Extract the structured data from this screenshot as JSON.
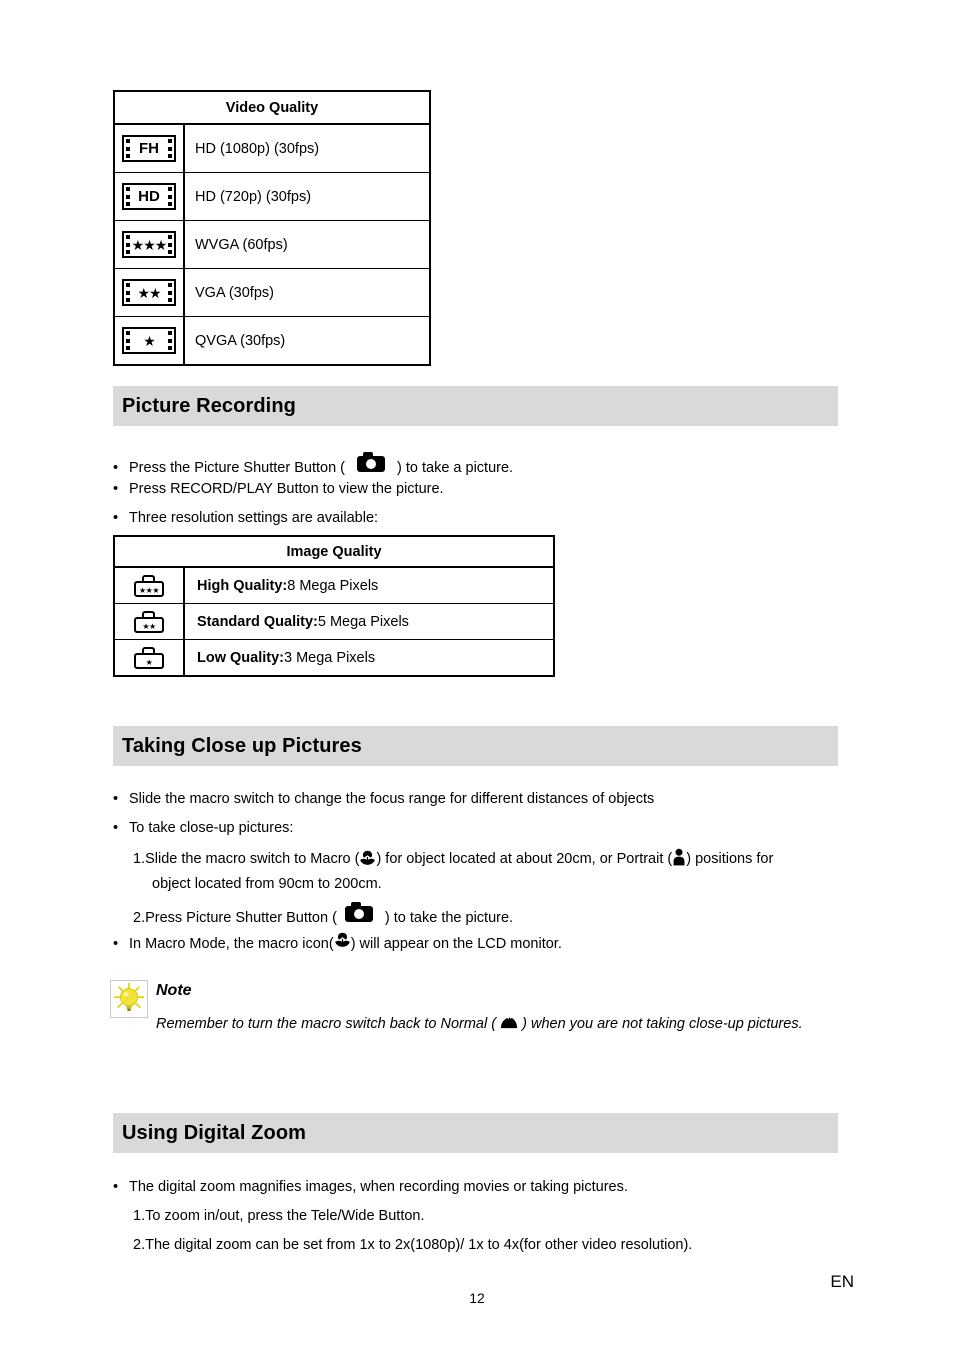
{
  "page": {
    "number": "12",
    "language_code": "EN"
  },
  "video_quality_table": {
    "header": "Video Quality",
    "rows": [
      {
        "icon": "film-fh-icon",
        "icon_text": "FH",
        "icon_kind": "text",
        "label": "HD (1080p) (30fps)"
      },
      {
        "icon": "film-hd-icon",
        "icon_text": "HD",
        "icon_kind": "text",
        "label": "HD (720p) (30fps)"
      },
      {
        "icon": "film-three-star-icon",
        "icon_text": "★★★",
        "icon_kind": "stars",
        "label": "WVGA (60fps)"
      },
      {
        "icon": "film-two-star-icon",
        "icon_text": "★★",
        "icon_kind": "stars",
        "label": "VGA (30fps)"
      },
      {
        "icon": "film-one-star-icon",
        "icon_text": "★",
        "icon_kind": "stars",
        "label": "QVGA (30fps)"
      }
    ]
  },
  "picture_recording": {
    "heading": "Picture Recording",
    "heading_bg": "#d9d9d9",
    "bullets": [
      {
        "pre": "Press the Picture Shutter Button (",
        "icon": "camera-icon",
        "post": ") to take a picture."
      },
      {
        "pre": "Press RECORD/PLAY Button to view the picture.",
        "icon": null,
        "post": ""
      },
      {
        "pre": "Three resolution settings are available:",
        "icon": null,
        "post": ""
      }
    ]
  },
  "image_quality_table": {
    "header": "Image Quality",
    "rows": [
      {
        "icon": "camera-three-star-icon",
        "stars": "★★★",
        "label_bold": "High Quality:",
        "label_rest": "8 Mega Pixels"
      },
      {
        "icon": "camera-two-star-icon",
        "stars": "★★",
        "label_bold": "Standard Quality:",
        "label_rest": "5 Mega Pixels"
      },
      {
        "icon": "camera-one-star-icon",
        "stars": "★",
        "label_bold": "Low Quality:",
        "label_rest": "3 Mega Pixels"
      }
    ]
  },
  "close_up": {
    "heading": "Taking Close up Pictures",
    "heading_bg": "#d9d9d9",
    "bullet1": "Slide the macro switch to change the focus range for different distances of objects",
    "bullet2": "To take close-up pictures:",
    "step1_part1": "1.Slide the macro switch to Macro (",
    "step1_part2": ") for object located at about 20cm, or Portrait (",
    "step1_part3": ") positions for",
    "step1_line2": "object located from 90cm to 200cm.",
    "step2_part1": "2.Press Picture Shutter Button (",
    "step2_part2": ") to take the picture.",
    "bullet3_part1": "In Macro Mode, the macro icon(",
    "bullet3_part2": ") will appear on the LCD monitor."
  },
  "note": {
    "title": "Note",
    "text_part1": "Remember to turn the macro switch back to Normal ( ",
    "text_part2": " ) when you are not taking close-up pictures.",
    "bulb_color": "#f5e03c"
  },
  "digital_zoom": {
    "heading": "Using Digital Zoom",
    "heading_bg": "#d9d9d9",
    "bullet1": "The digital zoom magnifies images, when recording movies or taking pictures.",
    "step1": "1.To zoom in/out, press the Tele/Wide Button.",
    "step2": "2.The digital zoom can be set from 1x to 2x(1080p)/  1x to 4x(for other video resolution)."
  }
}
